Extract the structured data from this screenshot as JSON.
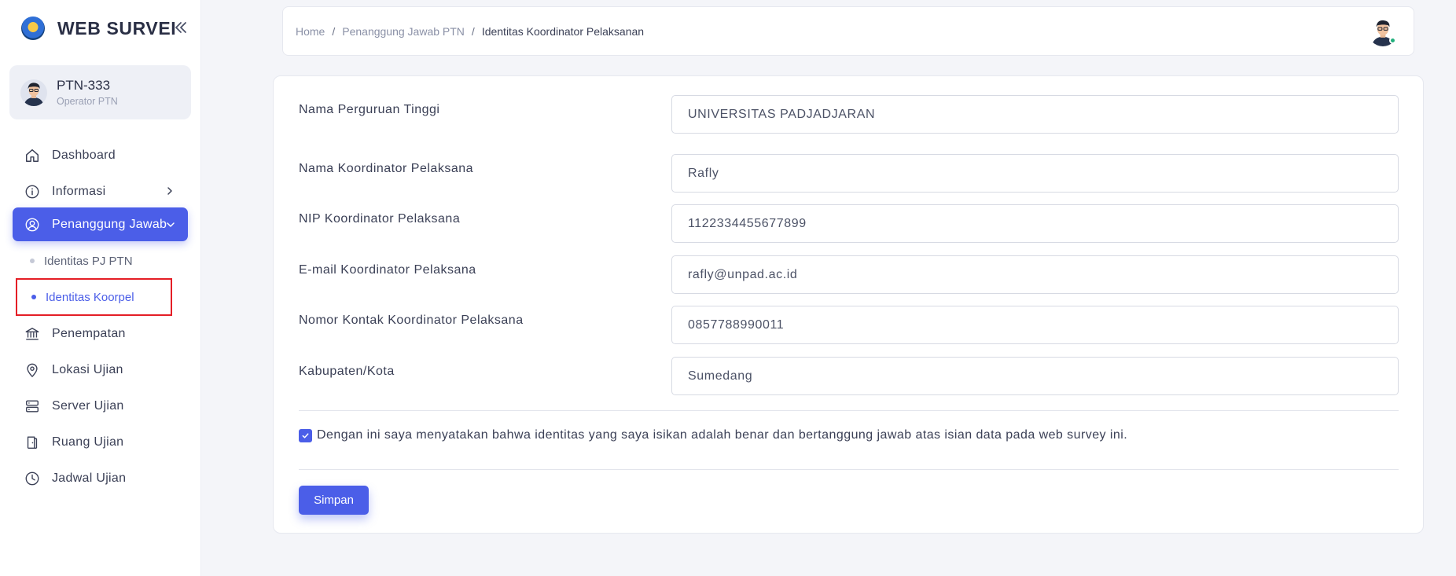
{
  "app": {
    "title": "WEB SURVEI"
  },
  "user": {
    "name": "PTN-333",
    "role": "Operator PTN"
  },
  "nav": {
    "dashboard": "Dashboard",
    "informasi": "Informasi",
    "penanggung_jawab": "Penanggung Jawab",
    "sub_pj_ptn": "Identitas PJ PTN",
    "sub_koorpel": "Identitas Koorpel",
    "penempatan": "Penempatan",
    "lokasi_ujian": "Lokasi Ujian",
    "server_ujian": "Server Ujian",
    "ruang_ujian": "Ruang Ujian",
    "jadwal_ujian": "Jadwal Ujian"
  },
  "breadcrumb": {
    "home": "Home",
    "parent": "Penanggung Jawab PTN",
    "current": "Identitas Koordinator Pelaksanan",
    "separator": "/"
  },
  "form": {
    "fields": [
      {
        "label": "Nama Perguruan Tinggi",
        "value": "UNIVERSITAS PADJADJARAN"
      },
      {
        "label": "Nama Koordinator Pelaksana",
        "value": "Rafly"
      },
      {
        "label": "NIP Koordinator Pelaksana",
        "value": "1122334455677899"
      },
      {
        "label": "E-mail Koordinator Pelaksana",
        "value": "rafly@unpad.ac.id"
      },
      {
        "label": "Nomor Kontak Koordinator Pelaksana",
        "value": "0857788990011"
      },
      {
        "label": "Kabupaten/Kota",
        "value": "Sumedang"
      }
    ],
    "consent_text": "Dengan ini saya menyatakan bahwa identitas yang saya isikan adalah benar dan bertanggung jawab atas isian data pada web survey ini.",
    "consent_checked": true,
    "save_label": "Simpan"
  },
  "colors": {
    "accent": "#4b5ee8",
    "highlight_box": "#e41e26",
    "online": "#22b07d"
  }
}
